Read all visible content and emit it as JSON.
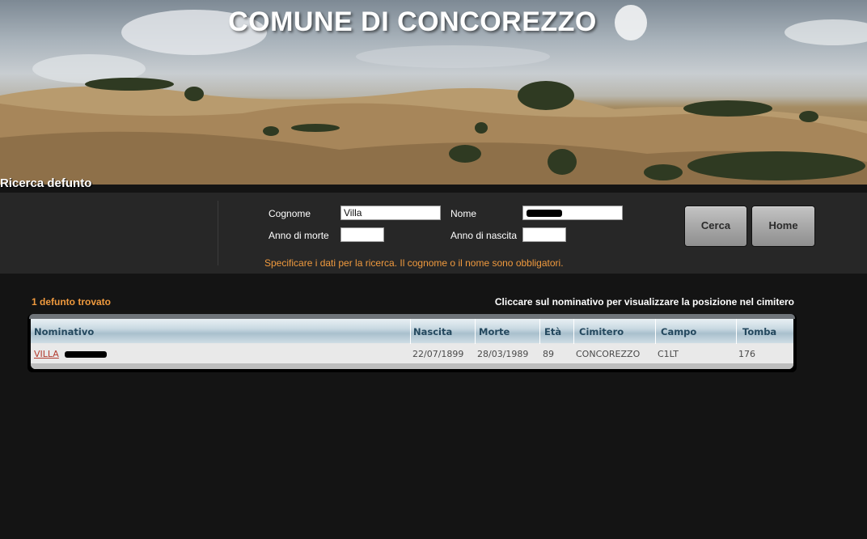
{
  "header": {
    "title": "COMUNE DI CONCOREZZO",
    "section": "Ricerca defunto"
  },
  "search": {
    "cognome_label": "Cognome",
    "cognome_value": "Villa",
    "nome_label": "Nome",
    "nome_value": "",
    "anno_morte_label": "Anno di morte",
    "anno_morte_value": "",
    "anno_nascita_label": "Anno di nascita",
    "anno_nascita_value": "",
    "hint": "Specificare i dati per la ricerca. Il cognome o il nome sono obbligatori.",
    "cerca_label": "Cerca",
    "home_label": "Home"
  },
  "results": {
    "count_text": "1 defunto trovato",
    "instructions": "Cliccare sul nominativo per visualizzare la posizione nel cimitero",
    "columns": [
      "Nominativo",
      "Nascita",
      "Morte",
      "Età",
      "Cimitero",
      "Campo",
      "Tomba"
    ],
    "rows": [
      {
        "nominativo": "VILLA",
        "nascita": "22/07/1899",
        "morte": "28/03/1989",
        "eta": "89",
        "cimitero": "CONCOREZZO",
        "campo": "C1LT",
        "tomba": "176"
      }
    ]
  },
  "colors": {
    "accent_orange": "#f09a3e",
    "link_red": "#b23a2e",
    "panel_bg": "#272727",
    "page_bg": "#141414"
  }
}
